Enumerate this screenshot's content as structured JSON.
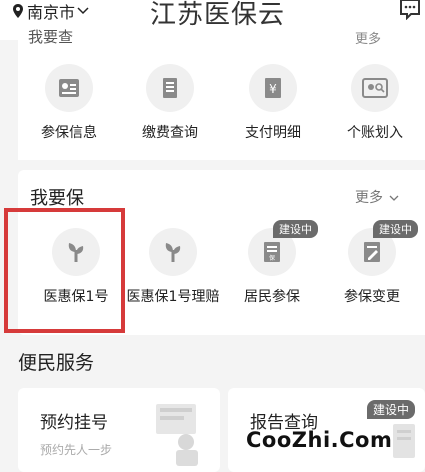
{
  "header": {
    "location": "南京市",
    "title": "江苏医保云"
  },
  "section_prev": {
    "title": "我要查",
    "more": "更多"
  },
  "query_items": [
    {
      "label": "参保信息",
      "icon": "id-card-icon"
    },
    {
      "label": "缴费查询",
      "icon": "receipt-icon"
    },
    {
      "label": "支付明细",
      "icon": "yen-doc-icon"
    },
    {
      "label": "个账划入",
      "icon": "account-search-icon"
    }
  ],
  "section_insure": {
    "title": "我要保",
    "more": "更多",
    "items": [
      {
        "label": "医惠保1号",
        "icon": "leaf-icon",
        "badge": ""
      },
      {
        "label": "医惠保1号理赔",
        "icon": "leaf-icon",
        "badge": ""
      },
      {
        "label": "居民参保",
        "icon": "insure-doc-icon",
        "badge": "建设中"
      },
      {
        "label": "参保变更",
        "icon": "edit-doc-icon",
        "badge": "建设中"
      }
    ]
  },
  "services": {
    "title": "便民服务",
    "cards": [
      {
        "title": "预约挂号",
        "subtitle": "预约先人一步",
        "badge": ""
      },
      {
        "title": "报告查询",
        "subtitle": "",
        "badge": "建设中"
      }
    ]
  },
  "watermark": "CooZhi.Com",
  "colors": {
    "highlight": "#d63a3a",
    "badge": "#6b6b6b"
  }
}
